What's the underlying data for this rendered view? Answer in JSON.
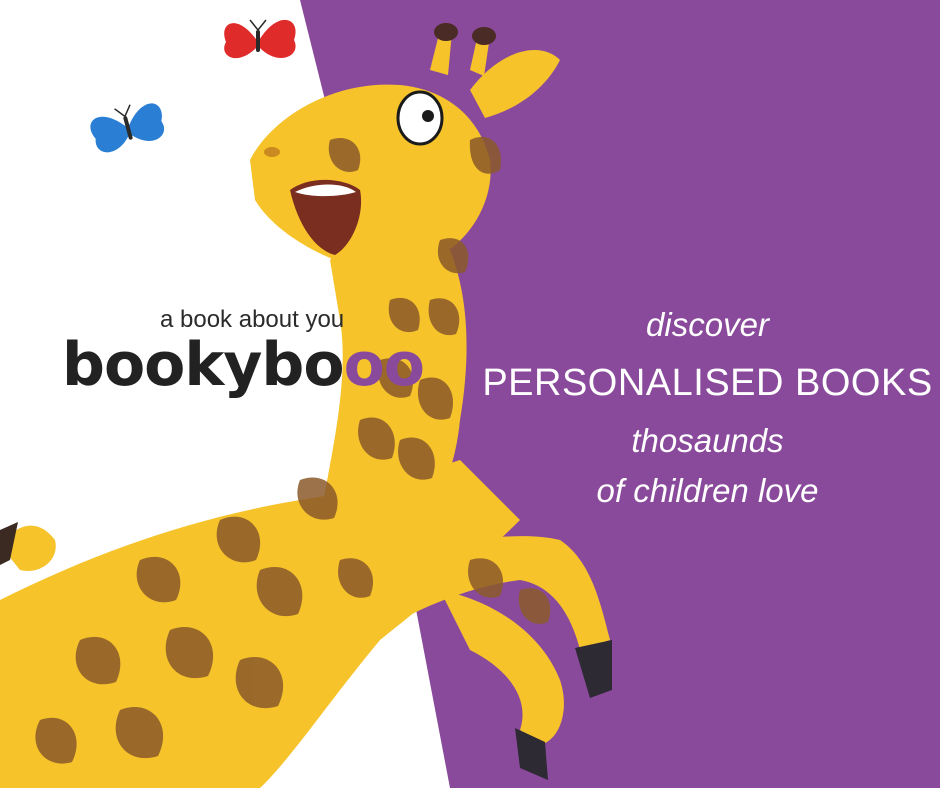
{
  "brand": {
    "tagline": "a book about you",
    "logo_text_main": "booky",
    "logo_text_tail": "bo",
    "logo_text_circles": "oo"
  },
  "promo": {
    "line1": "discover",
    "line2": "PERSONALISED BOOKS",
    "line3": "thosaunds",
    "line4": "of children love"
  },
  "colors": {
    "background_left": "#ffffff",
    "background_right": "#8a4a9c",
    "giraffe_body": "#f6c32a",
    "giraffe_spots": "#8b5a2b",
    "text_promo": "#ffffff",
    "text_brand": "#222222",
    "butterfly_red": "#e02b2b",
    "butterfly_blue": "#2a7fd4"
  },
  "illustration": {
    "subject": "giraffe-icon",
    "decorations": [
      "butterfly-red-icon",
      "butterfly-blue-icon"
    ]
  }
}
